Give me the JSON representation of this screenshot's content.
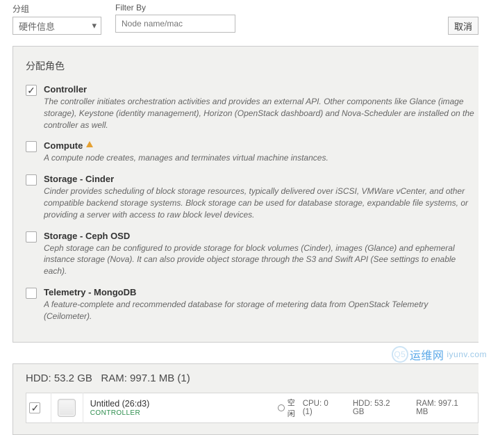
{
  "filters": {
    "group_label": "分组",
    "group_value": "硬件信息",
    "filter_label": "Filter By",
    "filter_placeholder": "Node name/mac",
    "cancel": "取消"
  },
  "roles_panel": {
    "title": "分配角色",
    "items": [
      {
        "name": "Controller",
        "desc": "The controller initiates orchestration activities and provides an external API. Other components like Glance (image storage), Keystone (identity management), Horizon (OpenStack dashboard) and Nova-Scheduler are installed on the controller as well.",
        "checked": true,
        "warn": false
      },
      {
        "name": "Compute",
        "desc": "A compute node creates, manages and terminates virtual machine instances.",
        "checked": false,
        "warn": true
      },
      {
        "name": "Storage - Cinder",
        "desc": "Cinder provides scheduling of block storage resources, typically delivered over iSCSI, VMWare vCenter, and other compatible backend storage systems. Block storage can be used for database storage, expandable file systems, or providing a server with access to raw block level devices.",
        "checked": false,
        "warn": false
      },
      {
        "name": "Storage - Ceph OSD",
        "desc": "Ceph storage can be configured to provide storage for block volumes (Cinder), images (Glance) and ephemeral instance storage (Nova). It can also provide object storage through the S3 and Swift API (See settings to enable each).",
        "checked": false,
        "warn": false
      },
      {
        "name": "Telemetry - MongoDB",
        "desc": "A feature-complete and recommended database for storage of metering data from OpenStack Telemetry (Ceilometer).",
        "checked": false,
        "warn": false
      }
    ]
  },
  "nodes_panel": {
    "hdd_label": "HDD: 53.2 GB",
    "ram_label": "RAM: 997.1 MB (1)",
    "node": {
      "title": "Untitled (26:d3)",
      "role_tag": "CONTROLLER",
      "status": "空闲",
      "cpu": "CPU: 0 (1)",
      "hdd": "HDD: 53.2 GB",
      "ram": "RAM: 997.1 MB"
    }
  },
  "watermark": {
    "text": "运维网",
    "domain": "iyunv.com"
  }
}
